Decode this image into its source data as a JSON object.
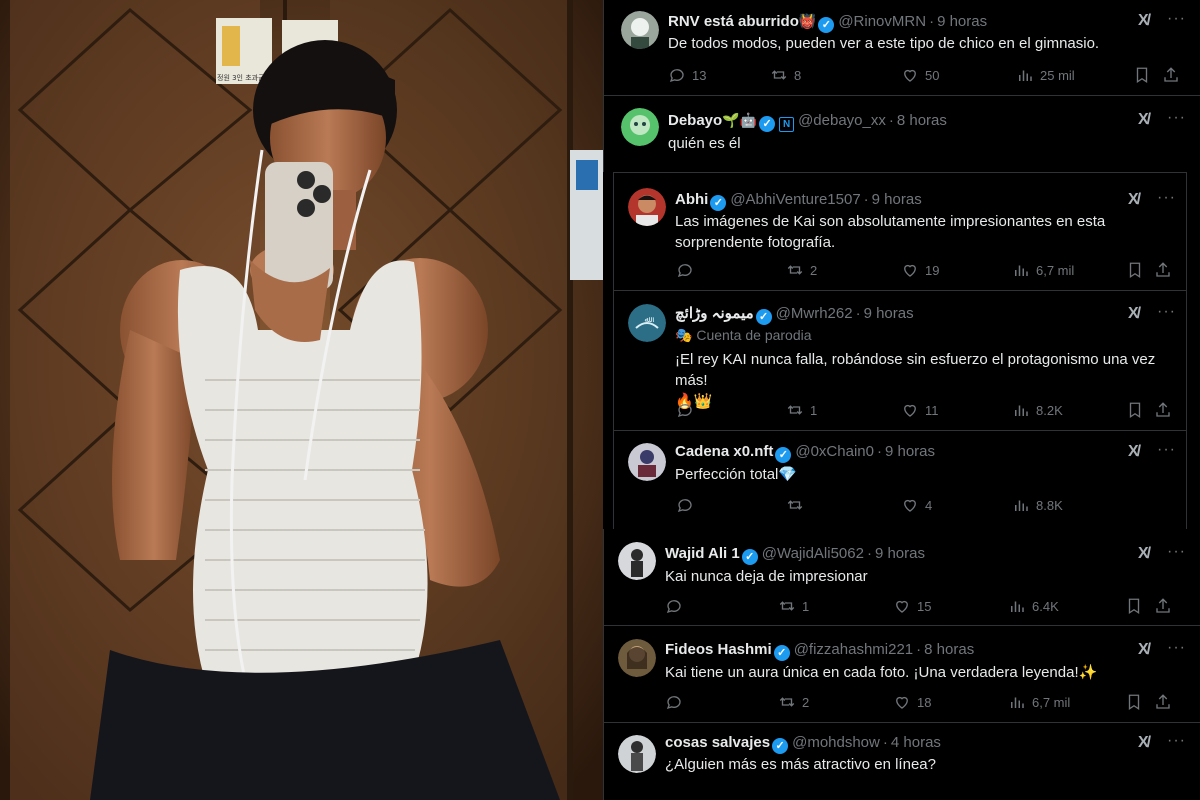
{
  "theme": {
    "background": "#000000",
    "text": "#e7e9ea",
    "muted": "#71767b",
    "divider": "#2f3336",
    "verified": "#1d9bf0"
  },
  "photo": {
    "sign_text": "정원 3인 초과금지"
  },
  "tweets": [
    {
      "name": "RNV está aburrido",
      "name_emoji": "👹",
      "handle": "@RinovMRN",
      "time": "9 horas",
      "text": "De todos modos, pueden ver a este tipo de chico en el gimnasio.",
      "replies": "13",
      "reposts": "8",
      "likes": "50",
      "views": "25 mil",
      "avatar_color": "#9aa59c"
    },
    {
      "name": "Debayo",
      "name_emoji": "🌱🤖",
      "handle": "@debayo_xx",
      "time": "8 horas",
      "text": "quién es él",
      "avatar_color": "#56c26b"
    },
    {
      "name": "Abhi",
      "handle": "@AbhiVenture1507",
      "time": "9 horas",
      "text": "Las imágenes de Kai son absolutamente impresionantes en esta sorprendente fotografía.",
      "replies": "",
      "reposts": "2",
      "likes": "19",
      "views": "6,7 mil",
      "avatar_color": "#b3352b"
    },
    {
      "name": "ميمونہ وڑائچ",
      "handle": "@Mwrh262",
      "time": "9 horas",
      "parody_label": "Cuenta de parodia",
      "text": "¡El rey KAI nunca falla, robándose sin esfuerzo el protagonismo una vez más!",
      "text_emoji": "🔥👑",
      "replies": "",
      "reposts": "1",
      "likes": "11",
      "views": "8.2K",
      "avatar_color": "#2b6e86"
    },
    {
      "name": "Cadena x0.nft",
      "handle": "@0xChain0",
      "time": "9 horas",
      "text": "Perfección total",
      "text_emoji": "💎",
      "replies": "",
      "reposts": "",
      "likes": "4",
      "views": "8.8K",
      "avatar_color": "#c9c9d4"
    },
    {
      "name": "Wajid Ali 1",
      "handle": "@WajidAli5062",
      "time": "9 horas",
      "text": "Kai nunca deja de impresionar",
      "replies": "",
      "reposts": "1",
      "likes": "15",
      "views": "6.4K",
      "avatar_color": "#d6d8dc"
    },
    {
      "name": "Fideos Hashmi",
      "handle": "@fizzahashmi221",
      "time": "8 horas",
      "text": "Kai tiene un aura única en cada foto. ¡Una verdadera leyenda!",
      "text_emoji": "✨",
      "replies": "",
      "reposts": "2",
      "likes": "18",
      "views": "6,7 mil",
      "avatar_color": "#6e5a3c"
    },
    {
      "name": "cosas salvajes",
      "handle": "@mohdshow",
      "time": "4 horas",
      "text": "¿Alguien más es más atractivo en línea?",
      "avatar_color": "#cfd3d6"
    }
  ],
  "icons": {
    "grok": "grok-icon",
    "more": "more-icon",
    "reply": "reply-icon",
    "repost": "repost-icon",
    "like": "like-icon",
    "views": "views-icon",
    "bookmark": "bookmark-icon",
    "share": "share-icon",
    "verified": "verified-badge-icon",
    "parody": "parody-mask-icon"
  },
  "symbols": {
    "verified": "✓",
    "grok": "X/",
    "more": "···",
    "org_badge": "N",
    "dot": "·",
    "parody_mask": "🎭"
  }
}
